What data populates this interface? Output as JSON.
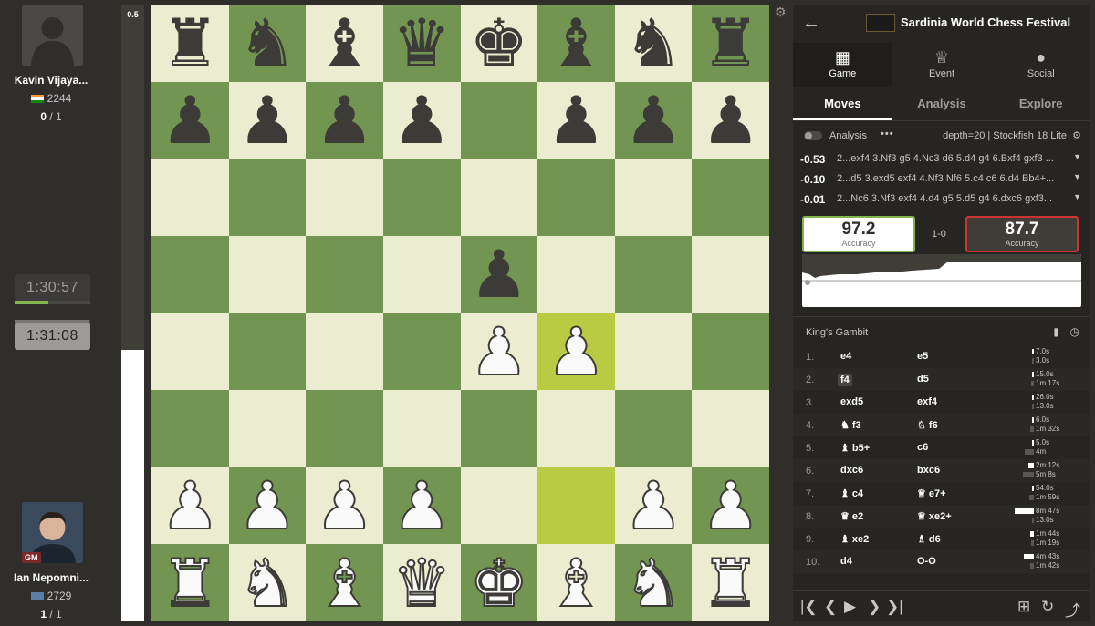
{
  "players": {
    "top": {
      "name": "Kavin Vijaya...",
      "rating": "2244",
      "score_won": "0",
      "score_total": " / 1",
      "clock": "1:30:57",
      "clock_progress": 0.45
    },
    "bottom": {
      "name": "Ian Nepomni...",
      "rating": "2729",
      "score_won": "1",
      "score_total": " / 1",
      "clock": "1:31:08",
      "clock_progress": 0.98,
      "title": "GM"
    }
  },
  "eval": {
    "label": "0.5",
    "white_fraction": 0.44
  },
  "board": {
    "rows": [
      [
        "r",
        "n",
        "b",
        "q",
        "k",
        "b",
        "n",
        "r"
      ],
      [
        "p",
        "p",
        "p",
        "p",
        "",
        "p",
        "p",
        "p"
      ],
      [
        "",
        "",
        "",
        "",
        "",
        "",
        "",
        ""
      ],
      [
        "",
        "",
        "",
        "",
        "p",
        "",
        "",
        ""
      ],
      [
        "",
        "",
        "",
        "",
        "P",
        "P",
        "",
        ""
      ],
      [
        "",
        "",
        "",
        "",
        "",
        "",
        "",
        ""
      ],
      [
        "P",
        "P",
        "P",
        "P",
        "",
        "",
        "P",
        "P"
      ],
      [
        "R",
        "N",
        "B",
        "Q",
        "K",
        "B",
        "N",
        "R"
      ]
    ],
    "highlights": [
      "f4",
      "f2"
    ]
  },
  "panel": {
    "event_title": "Sardinia World Chess Festival",
    "top_tabs": [
      "Game",
      "Event",
      "Social"
    ],
    "sub_tabs": [
      "Moves",
      "Analysis",
      "Explore"
    ],
    "analysis_label": "Analysis",
    "engine_info": "depth=20 | Stockfish 18 Lite",
    "lines": [
      {
        "score": "-0.53",
        "moves": "2...exf4 3.Nf3 g5 4.Nc3 d6 5.d4 g4 6.Bxf4 gxf3 ..."
      },
      {
        "score": "-0.10",
        "moves": "2...d5 3.exd5 exf4 4.Nf3 Nf6 5.c4 c6 6.d4 Bb4+..."
      },
      {
        "score": "-0.01",
        "moves": "2...Nc6 3.Nf3 exf4 4.d4 g5 5.d5 g4 6.dxc6 gxf3..."
      }
    ],
    "accuracy": {
      "white": "97.2",
      "black": "87.7",
      "label": "Accuracy",
      "result": "1-0"
    },
    "opening": "King's Gambit",
    "moves": [
      {
        "num": "1.",
        "white": "e4",
        "black": "e5",
        "wt": "7.0s",
        "bt": "3.0s",
        "wf": 0.03,
        "bf": 0.01
      },
      {
        "num": "2.",
        "white": "f4",
        "black": "d5",
        "wt": "15.0s",
        "bt": "1m 17s",
        "wf": 0.05,
        "bf": 0.14
      },
      {
        "num": "3.",
        "white": "exd5",
        "black": "exf4",
        "wt": "26.0s",
        "bt": "13.0s",
        "wf": 0.08,
        "bf": 0.04
      },
      {
        "num": "4.",
        "white": "♞ f3",
        "black": "♘ f6",
        "wt": "6.0s",
        "bt": "1m 32s",
        "wf": 0.02,
        "bf": 0.17
      },
      {
        "num": "5.",
        "white": "♝ b5+",
        "black": "c6",
        "wt": "5.0s",
        "bt": "4m",
        "wf": 0.02,
        "bf": 0.45
      },
      {
        "num": "6.",
        "white": "dxc6",
        "black": "bxc6",
        "wt": "2m 12s",
        "bt": "5m 8s",
        "wf": 0.25,
        "bf": 0.55
      },
      {
        "num": "7.",
        "white": "♝ c4",
        "black": "♕ e7+",
        "wt": "54.0s",
        "bt": "1m 59s",
        "wf": 0.1,
        "bf": 0.22
      },
      {
        "num": "8.",
        "white": "♛ e2",
        "black": "♕ xe2+",
        "wt": "8m 47s",
        "bt": "13.0s",
        "wf": 0.95,
        "bf": 0.04
      },
      {
        "num": "9.",
        "white": "♝ xe2",
        "black": "♗ d6",
        "wt": "1m 44s",
        "bt": "1m 19s",
        "wf": 0.19,
        "bf": 0.15
      },
      {
        "num": "10.",
        "white": "d4",
        "black": "O-O",
        "wt": "4m 43s",
        "bt": "1m 42s",
        "wf": 0.5,
        "bf": 0.19
      }
    ],
    "selected_move": "f4",
    "accent_green": "#81b64c",
    "accent_red": "#cc3333"
  }
}
